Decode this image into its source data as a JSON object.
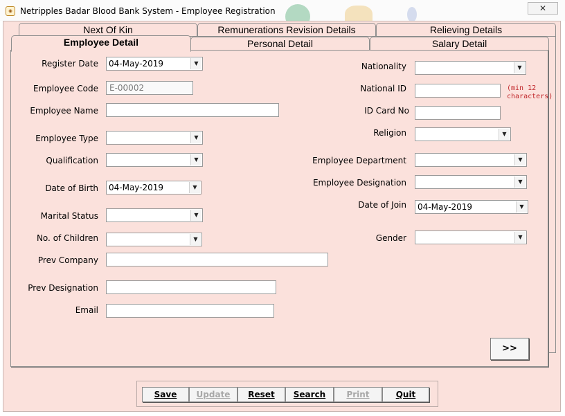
{
  "window": {
    "title": "Netripples Badar Blood Bank System - Employee Registration",
    "close_icon": "close-icon"
  },
  "tabs_back": [
    "Next Of Kin",
    "Remunerations Revision Details",
    "Relieving Details"
  ],
  "tabs_front": [
    "Employee Detail",
    "Personal Detail",
    "Salary Detail"
  ],
  "active_tab": "Employee Detail",
  "left_fields": {
    "register_date": {
      "label": "Register Date",
      "value": "04-May-2019"
    },
    "employee_code": {
      "label": "Employee Code",
      "value": "E-00002"
    },
    "employee_name": {
      "label": "Employee Name",
      "value": ""
    },
    "employee_type": {
      "label": "Employee Type",
      "value": ""
    },
    "qualification": {
      "label": "Qualification",
      "value": ""
    },
    "date_of_birth": {
      "label": "Date of Birth",
      "value": "04-May-2019"
    },
    "marital_status": {
      "label": "Marital Status",
      "value": ""
    },
    "no_of_children": {
      "label": "No. of Children",
      "value": ""
    },
    "prev_company": {
      "label": "Prev Company",
      "value": ""
    },
    "prev_designation": {
      "label": "Prev Designation",
      "value": ""
    },
    "email": {
      "label": "Email",
      "value": ""
    }
  },
  "right_fields": {
    "nationality": {
      "label": "Nationality",
      "value": ""
    },
    "national_id": {
      "label": "National ID",
      "value": "",
      "hint_line1": "(min 12",
      "hint_line2": "characters)"
    },
    "id_card_no": {
      "label": "ID Card No",
      "value": ""
    },
    "religion": {
      "label": "Religion",
      "value": ""
    },
    "employee_department": {
      "label": "Employee Department",
      "value": ""
    },
    "employee_designation": {
      "label": "Employee Designation",
      "value": ""
    },
    "date_of_join": {
      "label": "Date of Join",
      "value": "04-May-2019"
    },
    "gender": {
      "label": "Gender",
      "value": ""
    }
  },
  "next_button": ">>",
  "buttons": {
    "save": "Save",
    "update": "Update",
    "reset": "Reset",
    "search": "Search",
    "print": "Print",
    "quit": "Quit"
  },
  "colors": {
    "form_bg": "#fbe1dc",
    "hint": "#c0262a",
    "disabled_text": "#a8a8a8"
  }
}
